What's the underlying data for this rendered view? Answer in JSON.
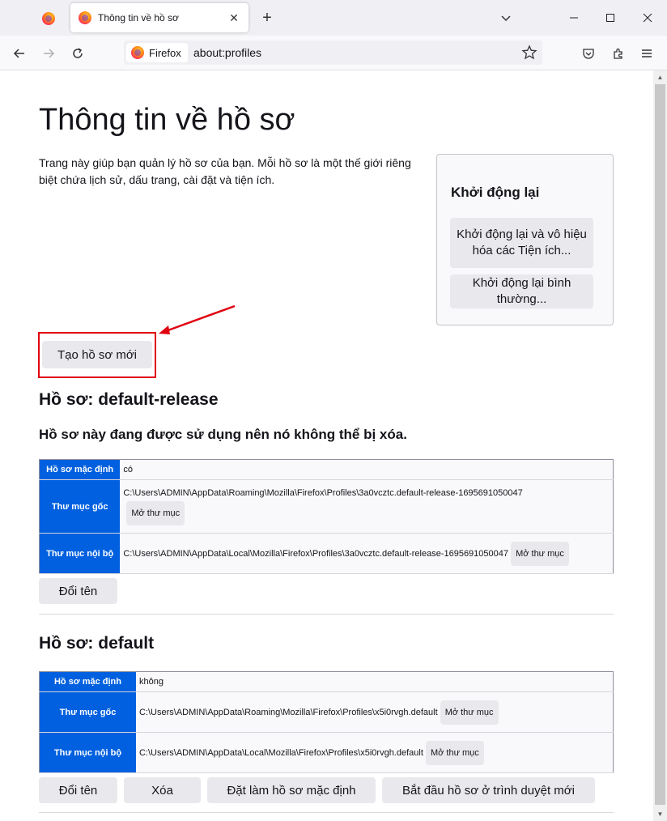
{
  "browser": {
    "tab_title": "Thông tin về hồ sơ",
    "identity_label": "Firefox",
    "url": "about:profiles"
  },
  "page": {
    "title": "Thông tin về hồ sơ",
    "intro": "Trang này giúp bạn quản lý hồ sơ của bạn. Mỗi hồ sơ là một thế giới riêng biệt chứa lịch sử, dấu trang, cài đặt và tiện ích.",
    "create_button": "Tạo hồ sơ mới",
    "restart": {
      "heading": "Khởi động lại",
      "restart_disable_addons": "Khởi động lại và vô hiệu hóa các Tiện ích...",
      "restart_normal": "Khởi động lại bình thường..."
    }
  },
  "profiles": [
    {
      "heading": "Hồ sơ: default-release",
      "in_use_note": "Hồ sơ này đang được sử dụng nên nó không thể bị xóa.",
      "rows": {
        "default_label": "Hồ sơ mặc định",
        "default_value": "có",
        "root_label": "Thư mục gốc",
        "root_path": "C:\\Users\\ADMIN\\AppData\\Roaming\\Mozilla\\Firefox\\Profiles\\3a0vcztc.default-release-1695691050047",
        "local_label": "Thư mục nội bộ",
        "local_path": "C:\\Users\\ADMIN\\AppData\\Local\\Mozilla\\Firefox\\Profiles\\3a0vcztc.default-release-1695691050047",
        "open_folder": "Mở thư mục"
      },
      "buttons": {
        "rename": "Đổi tên"
      }
    },
    {
      "heading": "Hồ sơ: default",
      "rows": {
        "default_label": "Hồ sơ mặc định",
        "default_value": "không",
        "root_label": "Thư mục gốc",
        "root_path": "C:\\Users\\ADMIN\\AppData\\Roaming\\Mozilla\\Firefox\\Profiles\\x5i0rvgh.default",
        "local_label": "Thư mục nội bộ",
        "local_path": "C:\\Users\\ADMIN\\AppData\\Local\\Mozilla\\Firefox\\Profiles\\x5i0rvgh.default",
        "open_folder": "Mở thư mục"
      },
      "buttons": {
        "rename": "Đổi tên",
        "remove": "Xóa",
        "set_default": "Đặt làm hồ sơ mặc định",
        "launch": "Bắt đầu hồ sơ ở trình duyệt mới"
      }
    }
  ],
  "colors": {
    "accent": "#0060df",
    "highlight": "#e0000f"
  }
}
